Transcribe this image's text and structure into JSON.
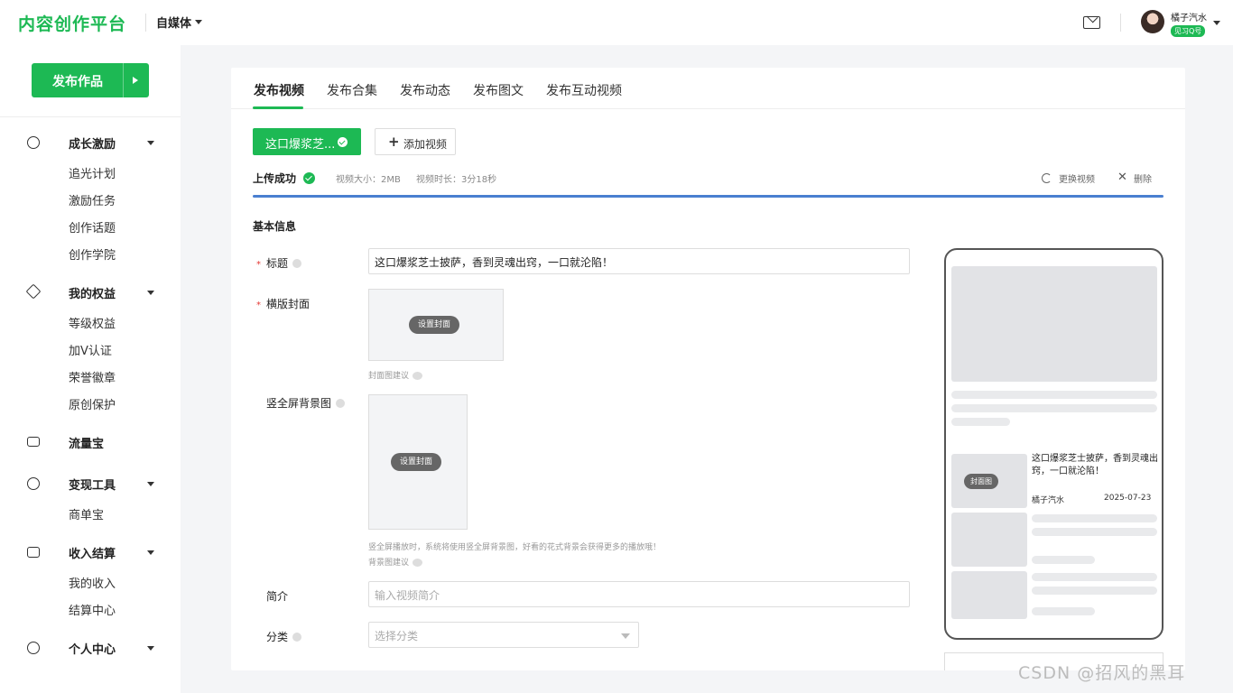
{
  "header": {
    "logo_text": "内容创作平台",
    "platform": "自媒体",
    "user_name": "橘子汽水",
    "user_badge": "见习Q号"
  },
  "sidebar": {
    "publish_button": "发布作品",
    "groups": [
      {
        "label": "成长激励",
        "icon": "medal-icon",
        "items": [
          "追光计划",
          "激励任务",
          "创作话题",
          "创作学院"
        ]
      },
      {
        "label": "我的权益",
        "icon": "diamond-icon",
        "items": [
          "等级权益",
          "加V认证",
          "荣誉徽章",
          "原创保护"
        ]
      },
      {
        "label": "流量宝",
        "icon": "ticket-icon",
        "items": []
      },
      {
        "label": "变现工具",
        "icon": "yen-icon",
        "items": [
          "商单宝"
        ]
      },
      {
        "label": "收入结算",
        "icon": "wallet-icon",
        "items": [
          "我的收入",
          "结算中心"
        ]
      },
      {
        "label": "个人中心",
        "icon": "user-icon",
        "items": []
      }
    ]
  },
  "tabs": [
    "发布视频",
    "发布合集",
    "发布动态",
    "发布图文",
    "发布互动视频"
  ],
  "upload": {
    "video_chip": "这口爆浆芝...",
    "add_video": "添加视频",
    "status": "上传成功",
    "size": "视频大小：2MB",
    "duration": "视频时长：3分18秒",
    "replace": "更换视频",
    "delete": "删除",
    "progress": 1.0
  },
  "form": {
    "section_title": "基本信息",
    "title_label": "标题",
    "title_value": "这口爆浆芝士披萨，香到灵魂出窍，一口就沦陷！",
    "cover_label": "横版封面",
    "set_cover": "设置封面",
    "cover_hint": "封面图建议",
    "vertical_label": "竖全屏背景图",
    "vertical_hint": "竖全屏播放时，系统将使用竖全屏背景图，好看的花式背景会获得更多的播放哦！",
    "bg_hint": "背景图建议",
    "intro_label": "简介",
    "intro_placeholder": "输入视频简介",
    "category_label": "分类",
    "category_placeholder": "选择分类"
  },
  "preview": {
    "title": "这口爆浆芝士披萨，香到灵魂出窍，一口就沦陷！",
    "author": "橘子汽水",
    "date": "2025-07-23",
    "cover_tag": "封面图"
  },
  "watermark": "CSDN @招风的黑耳",
  "colors": {
    "accent": "#1db954",
    "progress": "#4a7fd0"
  }
}
